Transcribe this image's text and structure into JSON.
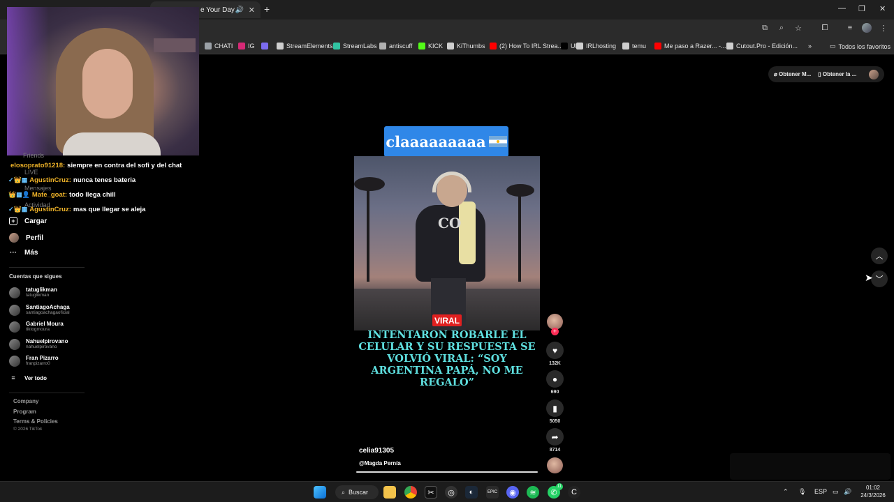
{
  "browser": {
    "active_tab_title": "e Your Day",
    "bookmarks": [
      {
        "label": "CHATI",
        "color": "#9aa0a6"
      },
      {
        "label": "IG",
        "color": "#d62976"
      },
      {
        "label": "",
        "color": "#7c6cf0"
      },
      {
        "label": "StreamElements",
        "color": "#cfcfcf"
      },
      {
        "label": "StreamLabs",
        "color": "#31c3a2"
      },
      {
        "label": "antiscuff",
        "color": "#b0b0b0"
      },
      {
        "label": "KICK",
        "color": "#53fc18"
      },
      {
        "label": "KiThumbs",
        "color": "#cfcfcf"
      },
      {
        "label": "(2) How To IRL Strea...",
        "color": "#ff0000"
      },
      {
        "label": "UP",
        "color": "#000000"
      },
      {
        "label": "IRLhosting",
        "color": "#cfcfcf"
      },
      {
        "label": "temu",
        "color": "#cfcfcf"
      },
      {
        "label": "Me paso a Razer... -...",
        "color": "#ff0000"
      },
      {
        "label": "Cutout.Pro - Edición...",
        "color": "#cfcfcf"
      }
    ],
    "more_bookmarks": "»",
    "all_favorites": "Todos los favoritos"
  },
  "chat": {
    "messages": [
      {
        "user": "elosoprato91218:",
        "text": "siempre en contra del sofi y del chat",
        "badges": ""
      },
      {
        "user": "AgustinCruz:",
        "text": "nunca tenes bateria",
        "badges": "✓👑▦"
      },
      {
        "user": "Mate_goat:",
        "text": "todo llega chill",
        "badges": "👑▦👤"
      },
      {
        "user": "AgustinCruz:",
        "text": "mas que llegar se aleja",
        "badges": "✓👑▦"
      }
    ],
    "ghost": {
      "friends": "Friends",
      "live": "LIVE",
      "messages": "Mensajes",
      "activity": "Actividad"
    }
  },
  "sidebar": {
    "items": [
      {
        "label": "Cargar",
        "icon": "upload-icon"
      },
      {
        "label": "Perfil",
        "icon": "profile-avatar"
      },
      {
        "label": "Más",
        "icon": "more-icon"
      }
    ],
    "following_title": "Cuentas que sigues",
    "following": [
      {
        "name": "tatuglikman",
        "handle": "tatuglikman"
      },
      {
        "name": "SantiagoAchaga",
        "handle": "santiagoachagaoficial"
      },
      {
        "name": "Gabriel Moura",
        "handle": "tiktogmoura"
      },
      {
        "name": "Nahuelpirovano",
        "handle": "nahuelpirovano"
      },
      {
        "name": "Fran Pizarro",
        "handle": "franpizarro0"
      }
    ],
    "see_all": "Ver todo",
    "footer": [
      "Company",
      "Program",
      "Terms & Policies"
    ],
    "copyright": "© 2026 TikTok"
  },
  "top_actions": {
    "get_app": "Obtener M...",
    "get_desktop": "Obtener la ..."
  },
  "video": {
    "caption_text": "claaaaaaaaa",
    "viral_tag": "VIRAL",
    "headline": "INTENTARON ROBARLE EL CELULAR Y SU RESPUESTA SE VOLVIÓ VIRAL: “SOY ARGENTINA PAPÁ, NO ME REGALO”",
    "shirt_text": "CO",
    "author": "celia91305",
    "music": "@Magda Pernía",
    "progress": 1.0
  },
  "actions": {
    "likes": "132K",
    "comments": "690",
    "saves": "5050",
    "shares": "8714"
  },
  "taskbar": {
    "search_label": "Buscar",
    "language": "ESP",
    "time": "01:02",
    "date": "24/3/2026",
    "whatsapp_badge": "11"
  }
}
